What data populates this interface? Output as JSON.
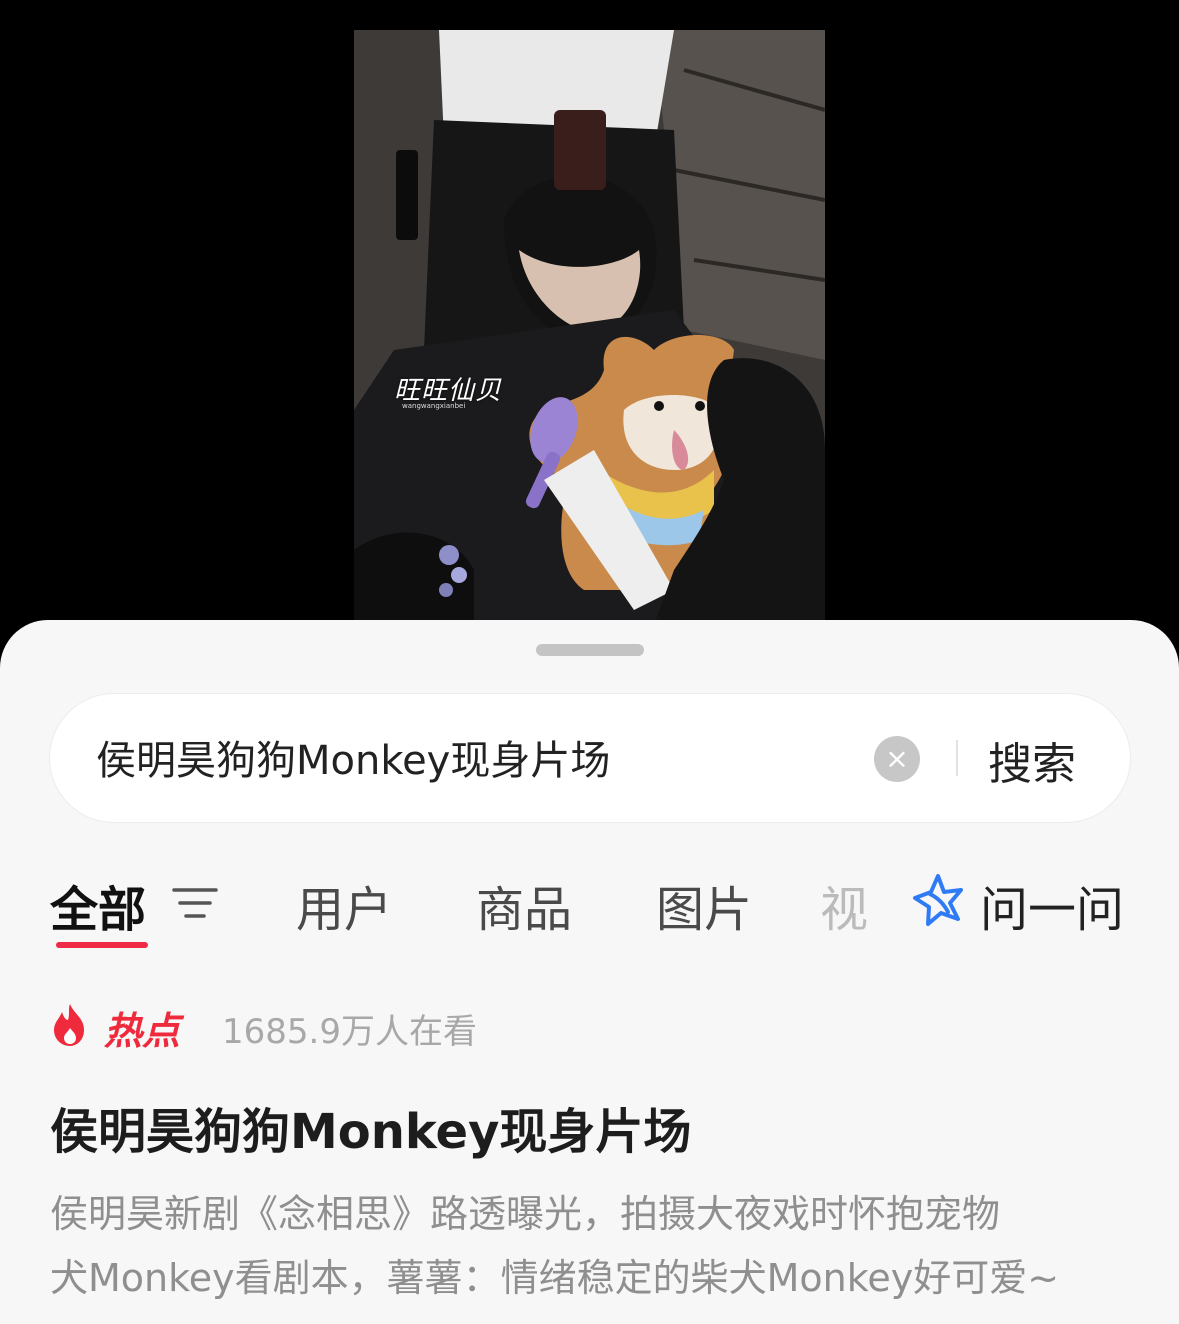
{
  "video": {
    "watermark": "旺旺仙贝",
    "watermark_sub": "wangwangxianbei"
  },
  "search": {
    "query": "侯明昊狗狗Monkey现身片场",
    "clear_glyph": "×",
    "button_label": "搜索"
  },
  "tabs": {
    "items": [
      "全部",
      "用户",
      "商品",
      "图片"
    ],
    "partial_tab": "视",
    "ask_label": "问一问"
  },
  "hot": {
    "label": "热点",
    "viewers": "1685.9万人在看"
  },
  "topic": {
    "title": "侯明昊狗狗Monkey现身片场",
    "desc_line1": "侯明昊新剧《念相思》路透曝光，拍摄大夜戏时怀抱宠物",
    "desc_line2": "犬Monkey看剧本，薯薯：情绪稳定的柴犬Monkey好可爱~"
  },
  "colors": {
    "accent": "#ee2a44",
    "ask_icon": "#2f7bf5",
    "sheet_bg": "#f7f7f7"
  }
}
